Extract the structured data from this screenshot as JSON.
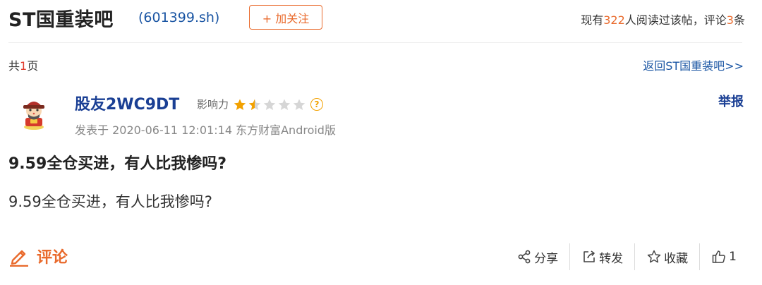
{
  "header": {
    "bar_title": "ST国重装吧",
    "stock_code": "(601399.sh)",
    "follow_label": "+ 加关注",
    "read_prefix": "现有",
    "read_count": "322",
    "read_mid": "人阅读过该帖，评论",
    "comment_count": "3",
    "read_suffix": "条"
  },
  "pager": {
    "prefix": "共",
    "pages": "1",
    "suffix": "页",
    "back_link": "返回ST国重装吧>>"
  },
  "post": {
    "author": "股友2WC9DT",
    "influence_label": "影响力",
    "influence_stars": 1.5,
    "influence_max": 5,
    "help_glyph": "?",
    "report_label": "举报",
    "meta": "发表于 2020-06-11 12:01:14 东方财富Android版",
    "title": "9.59全仓买进，有人比我惨吗?",
    "body": "9.59全仓买进，有人比我惨吗?"
  },
  "footer": {
    "comment_label": "评论",
    "share_label": "分享",
    "forward_label": "转发",
    "collect_label": "收藏",
    "like_count": "1"
  },
  "colors": {
    "accent": "#e96a2c",
    "link": "#1a55a3",
    "username": "#1a3f94",
    "star_on": "#f2a100",
    "star_off": "#d6d6d6"
  },
  "icons": [
    "avatar-caishen",
    "star-icon",
    "help-icon",
    "pen-icon",
    "share-icon",
    "forward-icon",
    "star-outline-icon",
    "thumbs-up-icon"
  ]
}
